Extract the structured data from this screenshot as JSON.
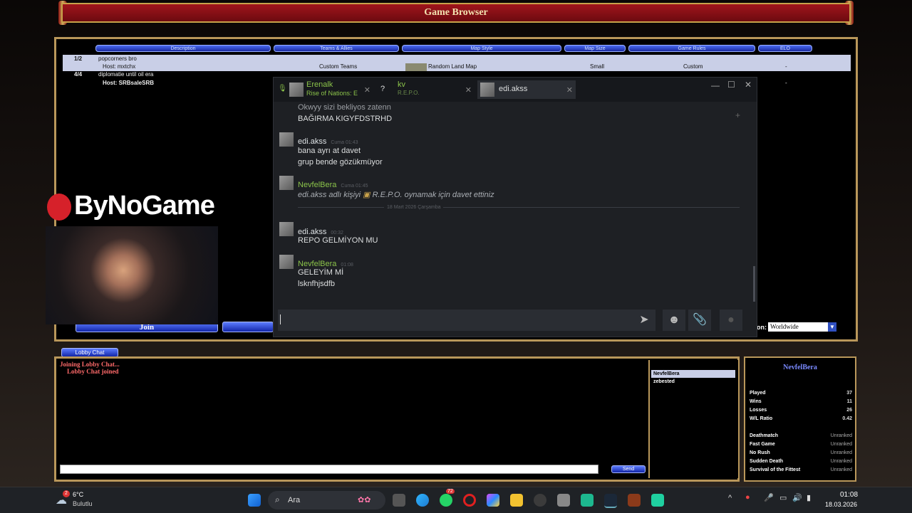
{
  "game": {
    "title": "Game Browser",
    "columns": [
      "Description",
      "Teams & Allies",
      "Map Style",
      "Map Size",
      "Game Rules",
      "ELO"
    ],
    "rows": [
      {
        "players": "1/2",
        "name": "popcorners bro",
        "host": "Host: mxtchx",
        "teams": "Custom Teams",
        "map": "Random Land Map",
        "size": "Small",
        "rules": "Custom",
        "elo": "-"
      },
      {
        "players": "4/4",
        "name": "diplomatie until oil era",
        "host": "Host: SRBsaleSRB",
        "elo": "-"
      }
    ],
    "join_label": "Join",
    "region_label": "on:",
    "region_value": "Worldwide",
    "lobby_tab": "Lobby Chat",
    "lobby_messages": [
      "Joining Lobby Chat...",
      "Lobby Chat joined"
    ],
    "send_label": "Send",
    "users": [
      "NevfelBera",
      "zebested"
    ],
    "player": {
      "name": "NevfelBera",
      "stats": [
        [
          "Played",
          "37"
        ],
        [
          "Wins",
          "11"
        ],
        [
          "Losses",
          "26"
        ],
        [
          "W/L Ratio",
          "0.42"
        ]
      ],
      "ranked": [
        [
          "Deathmatch",
          "Unranked"
        ],
        [
          "Fast Game",
          "Unranked"
        ],
        [
          "No Rush",
          "Unranked"
        ],
        [
          "Sudden Death",
          "Unranked"
        ],
        [
          "Survival of the Fittest",
          "Unranked"
        ]
      ]
    }
  },
  "overlay": {
    "logo": "ByNoGame"
  },
  "steam": {
    "tabs": [
      {
        "name": "Erenalk",
        "sub": "Rise of Nations: E"
      },
      {
        "name": "kv",
        "sub": "R.E.P.O."
      },
      {
        "name": "edi.akss"
      }
    ],
    "messages": {
      "m0a": "Okwyy sizi bekliyos zatenn",
      "m0b": "BAĞIRMA KIGYFDSTRHD",
      "m1_name": "edi.akss",
      "m1_time": "Cuma 01:43",
      "m1a": "bana ayrı at davet",
      "m1b": "grup bende gözükmüyor",
      "m2_name": "NevfelBera",
      "m2_time": "Cuma 01:45",
      "m2a": "edi.akss adlı kişiyi",
      "m2b": "R.E.P.O. oynamak için davet ettiniz",
      "divider": "18 Mart 2026 Çarşamba",
      "m3_name": "edi.akss",
      "m3_time": "00:32",
      "m3a": "REPO GELMİYON MU",
      "m4_name": "NevfelBera",
      "m4_time": "01:08",
      "m4a": "GELEYİM Mİ",
      "m4b": "lsknfhjsdfb"
    }
  },
  "taskbar": {
    "weather_temp": "6°C",
    "weather_desc": "Bulutlu",
    "search": "Ara",
    "time": "01:08",
    "date": "18.03.2026",
    "badge": "72"
  },
  "colors": {
    "steam_green": "#8bc34a",
    "game_red": "#a0151c",
    "lobby_red": "#ff6a6a"
  }
}
